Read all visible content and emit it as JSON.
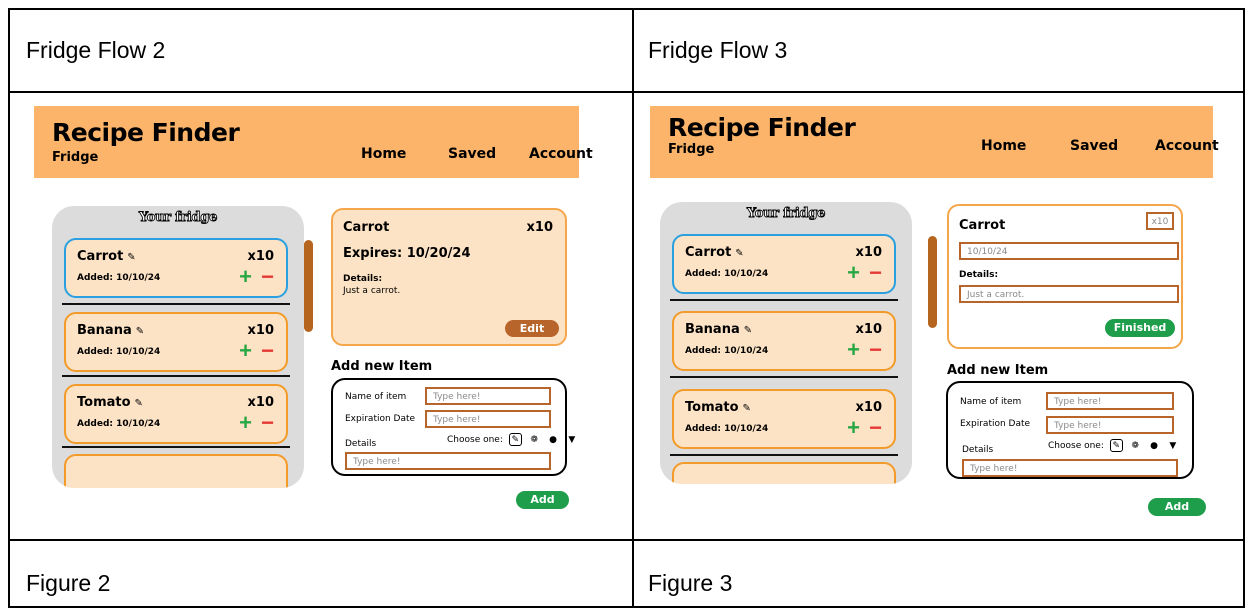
{
  "table": {
    "headers": [
      "Fridge Flow 2",
      "Fridge Flow 3"
    ],
    "footers": [
      "Figure 2",
      "Figure 3"
    ]
  },
  "colors": {
    "header": "#fbb469",
    "card_border": "#f29b2b",
    "selected_border": "#2aa0e0",
    "brown": "#b8652b",
    "green": "#1e9e4a",
    "plus": "#28a745",
    "minus": "#e53935"
  },
  "screens": [
    {
      "app": {
        "title": "Recipe Finder",
        "subtitle": "Fridge"
      },
      "nav": [
        "Home",
        "Saved",
        "Account"
      ],
      "fridge": {
        "title": "Your fridge",
        "items": [
          {
            "name": "Carrot",
            "icon": "carrot-icon",
            "qty": "x10",
            "added": "Added: 10/10/24"
          },
          {
            "name": "Banana",
            "icon": "carrot-icon",
            "qty": "x10",
            "added": "Added: 10/10/24"
          },
          {
            "name": "Tomato",
            "icon": "carrot-icon",
            "qty": "x10",
            "added": "Added: 10/10/24"
          }
        ]
      },
      "detail": {
        "name": "Carrot",
        "qty": "x10",
        "expires": "Expires: 10/20/24",
        "details_label": "Details:",
        "details": "Just a carrot.",
        "button": "Edit"
      },
      "add_form": {
        "title": "Add new Item",
        "name_label": "Name of item",
        "date_label": "Expiration Date",
        "choose_label": "Choose one:",
        "details_label": "Details",
        "placeholder": "Type here!",
        "choices": [
          "carrot-icon",
          "broccoli-icon",
          "mushroom-icon",
          "cup-icon"
        ],
        "button": "Add"
      }
    },
    {
      "app": {
        "title": "Recipe Finder",
        "subtitle": "Fridge"
      },
      "nav": [
        "Home",
        "Saved",
        "Account"
      ],
      "fridge": {
        "title": "Your fridge",
        "items": [
          {
            "name": "Carrot",
            "icon": "carrot-icon",
            "qty": "x10",
            "added": "Added: 10/10/24"
          },
          {
            "name": "Banana",
            "icon": "carrot-icon",
            "qty": "x10",
            "added": "Added: 10/10/24"
          },
          {
            "name": "Tomato",
            "icon": "carrot-icon",
            "qty": "x10",
            "added": "Added: 10/10/24"
          }
        ]
      },
      "detail": {
        "name": "Carrot",
        "qty_value": "x10",
        "date_value": "10/10/24",
        "details_label": "Details:",
        "details_value": "Just a carrot.",
        "button": "Finished"
      },
      "add_form": {
        "title": "Add new Item",
        "name_label": "Name of item",
        "date_label": "Expiration Date",
        "choose_label": "Choose one:",
        "details_label": "Details",
        "placeholder": "Type here!",
        "choices": [
          "carrot-icon",
          "broccoli-icon",
          "mushroom-icon",
          "cup-icon"
        ],
        "button": "Add"
      }
    }
  ]
}
